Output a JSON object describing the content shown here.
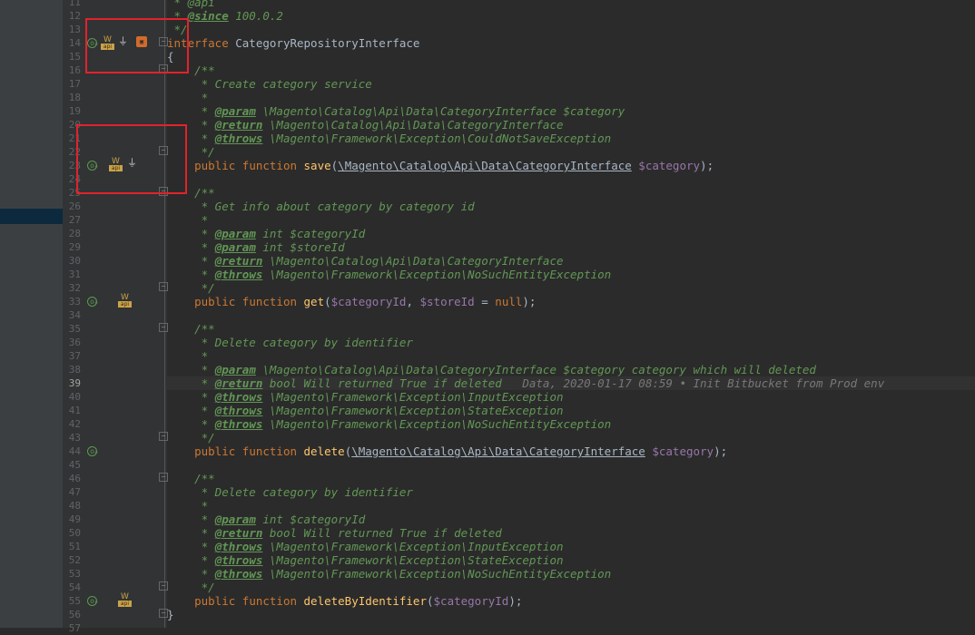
{
  "editor": {
    "line_numbers": [
      "11",
      "12",
      "13",
      "14",
      "15",
      "16",
      "17",
      "18",
      "19",
      "20",
      "21",
      "22",
      "23",
      "24",
      "25",
      "26",
      "27",
      "28",
      "29",
      "30",
      "31",
      "32",
      "33",
      "34",
      "35",
      "36",
      "37",
      "38",
      "39",
      "40",
      "41",
      "42",
      "43",
      "44",
      "45",
      "46",
      "47",
      "48",
      "49",
      "50",
      "51",
      "52",
      "53",
      "54",
      "55",
      "56",
      "57"
    ],
    "active_line": "39",
    "gutter_icons": {
      "api_badge_label": "api",
      "api_w_label": "W",
      "overrides_marker": "o",
      "down_arrow": "↓",
      "plugin_icon": "plug-icon",
      "orange_badge_label": "▣"
    },
    "lines": {
      "l11": " * @api",
      "l12_tag": "@since",
      "l12_rest": " 100.0.2",
      "l13": " */",
      "l14_kw": "interface",
      "l14_name": " CategoryRepositoryInterface",
      "l15": "{",
      "l16": "    /**",
      "l17": "     * Create category service",
      "l18": "     *",
      "l19_tag": "@param",
      "l19_rest": " \\Magento\\Catalog\\Api\\Data\\CategoryInterface $category",
      "l20_tag": "@return",
      "l20_rest": " \\Magento\\Catalog\\Api\\Data\\CategoryInterface",
      "l21_tag": "@throws",
      "l21_rest": " \\Magento\\Framework\\Exception\\CouldNotSaveException",
      "l22": "     */",
      "l23_kw": "public function",
      "l23_fn": " save",
      "l23_p1": "(",
      "l23_type": "\\Magento\\Catalog\\Api\\Data\\CategoryInterface",
      "l23_var": " $category",
      "l23_end": ");",
      "l25": "    /**",
      "l26": "     * Get info about category by category id",
      "l27": "     *",
      "l28_tag": "@param",
      "l28_rest": " int $categoryId",
      "l29_tag": "@param",
      "l29_rest": " int $storeId",
      "l30_tag": "@return",
      "l30_rest": " \\Magento\\Catalog\\Api\\Data\\CategoryInterface",
      "l31_tag": "@throws",
      "l31_rest": " \\Magento\\Framework\\Exception\\NoSuchEntityException",
      "l32": "     */",
      "l33_kw": "public function",
      "l33_fn": " get",
      "l33_p1": "(",
      "l33_var1": "$categoryId",
      "l33_comma": ", ",
      "l33_var2": "$storeId",
      "l33_eq": " = ",
      "l33_null": "null",
      "l33_end": ");",
      "l35": "    /**",
      "l36": "     * Delete category by identifier",
      "l37": "     *",
      "l38_tag": "@param",
      "l38_rest": " \\Magento\\Catalog\\Api\\Data\\CategoryInterface $category category which will deleted",
      "l39_tag": "@return",
      "l39_rest": " bool Will returned True if deleted",
      "l39_blame": "   Data, 2020-01-17 08:59 • Init Bitbucket from Prod env",
      "l40_tag": "@throws",
      "l40_rest": " \\Magento\\Framework\\Exception\\InputException",
      "l41_tag": "@throws",
      "l41_rest": " \\Magento\\Framework\\Exception\\StateException",
      "l42_tag": "@throws",
      "l42_rest": " \\Magento\\Framework\\Exception\\NoSuchEntityException",
      "l43": "     */",
      "l44_kw": "public function",
      "l44_fn": " delete",
      "l44_p1": "(",
      "l44_type": "\\Magento\\Catalog\\Api\\Data\\CategoryInterface",
      "l44_var": " $category",
      "l44_end": ");",
      "l46": "    /**",
      "l47": "     * Delete category by identifier",
      "l48": "     *",
      "l49_tag": "@param",
      "l49_rest": " int $categoryId",
      "l50_tag": "@return",
      "l50_rest": " bool Will returned True if deleted",
      "l51_tag": "@throws",
      "l51_rest": " \\Magento\\Framework\\Exception\\InputException",
      "l52_tag": "@throws",
      "l52_rest": " \\Magento\\Framework\\Exception\\StateException",
      "l53_tag": "@throws",
      "l53_rest": " \\Magento\\Framework\\Exception\\NoSuchEntityException",
      "l54": "     */",
      "l55_kw": "public function",
      "l55_fn": " deleteByIdentifier",
      "l55_p1": "(",
      "l55_var": "$categoryId",
      "l55_end": ");",
      "l56": "}",
      "doc_prefix": "     * "
    }
  },
  "colors": {
    "background": "#2b2b2b",
    "gutter": "#313335",
    "keyword": "#cc7832",
    "doc_comment": "#629755",
    "variable": "#9876aa",
    "function": "#ffc66d",
    "annotation_box": "#e3222c"
  }
}
